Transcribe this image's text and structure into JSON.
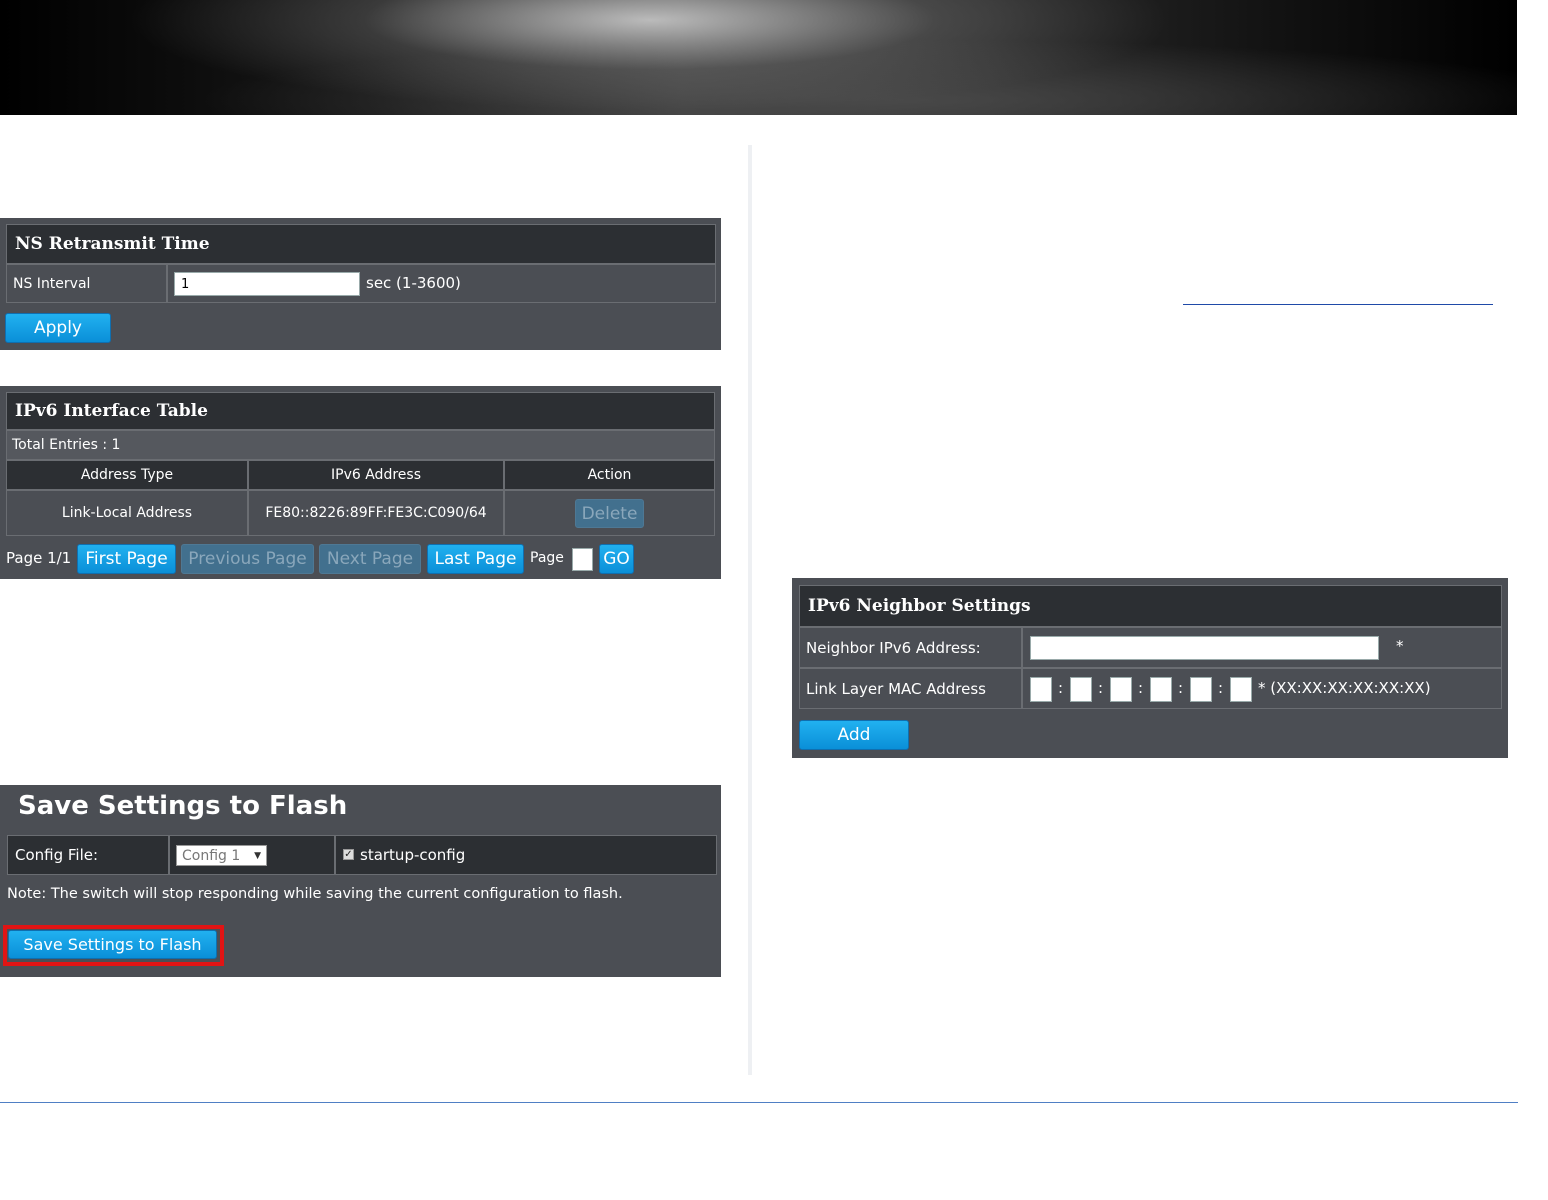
{
  "ns_panel": {
    "title": "NS Retransmit Time",
    "interval_label": "NS Interval",
    "interval_value": "1",
    "interval_hint": "sec (1-3600)",
    "apply_label": "Apply"
  },
  "ipv6_table": {
    "title": "IPv6 Interface Table",
    "total_entries": "Total Entries : 1",
    "columns": [
      "Address Type",
      "IPv6 Address",
      "Action"
    ],
    "rows": [
      {
        "address_type": "Link-Local Address",
        "ipv6_address": "FE80::8226:89FF:FE3C:C090/64",
        "action": "Delete"
      }
    ],
    "pager": {
      "page_info": "Page 1/1",
      "first": "First Page",
      "previous": "Previous Page",
      "next": "Next Page",
      "last": "Last Page",
      "page_label": "Page",
      "go": "GO"
    }
  },
  "save_panel": {
    "title": "Save Settings to Flash",
    "config_label": "Config File:",
    "config_selected": "Config 1",
    "checkbox_label": "startup-config",
    "checkbox_checked": true,
    "note": "Note: The switch will stop responding while saving the current configuration to flash.",
    "save_button": "Save Settings to Flash"
  },
  "neighbor_panel": {
    "title": "IPv6 Neighbor Settings",
    "address_label": "Neighbor IPv6 Address:",
    "address_required": "*",
    "mac_label": "Link Layer MAC Address",
    "mac_separator": ":",
    "mac_hint": "* (XX:XX:XX:XX:XX:XX)",
    "add_label": "Add"
  },
  "colors": {
    "panel_bg": "#4b4e54",
    "header_bg": "#2c2f33",
    "button_blue": "#0a8fd8",
    "highlight_red": "#e01414"
  }
}
